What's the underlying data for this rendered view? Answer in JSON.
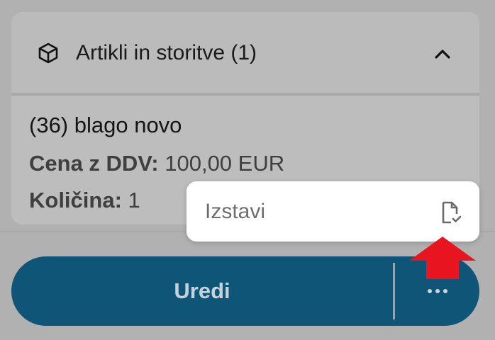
{
  "card": {
    "title": "Artikli in storitve (1)",
    "item": {
      "name": "(36) blago novo",
      "price_label": "Cena z DDV:",
      "price_value": "100,00 EUR",
      "qty_label": "Količina:",
      "qty_value": "1"
    }
  },
  "popup": {
    "label": "Izstavi"
  },
  "action_bar": {
    "edit_label": "Uredi"
  },
  "icons": {
    "section": "box-icon",
    "collapse": "chevron-up-icon",
    "issue": "document-check-icon",
    "more": "more-horizontal-icon",
    "pointer": "arrow-up-icon"
  },
  "colors": {
    "primary": "#0e5577",
    "pointer": "#e8141f",
    "overlay_bg": "#b1b1b1"
  }
}
